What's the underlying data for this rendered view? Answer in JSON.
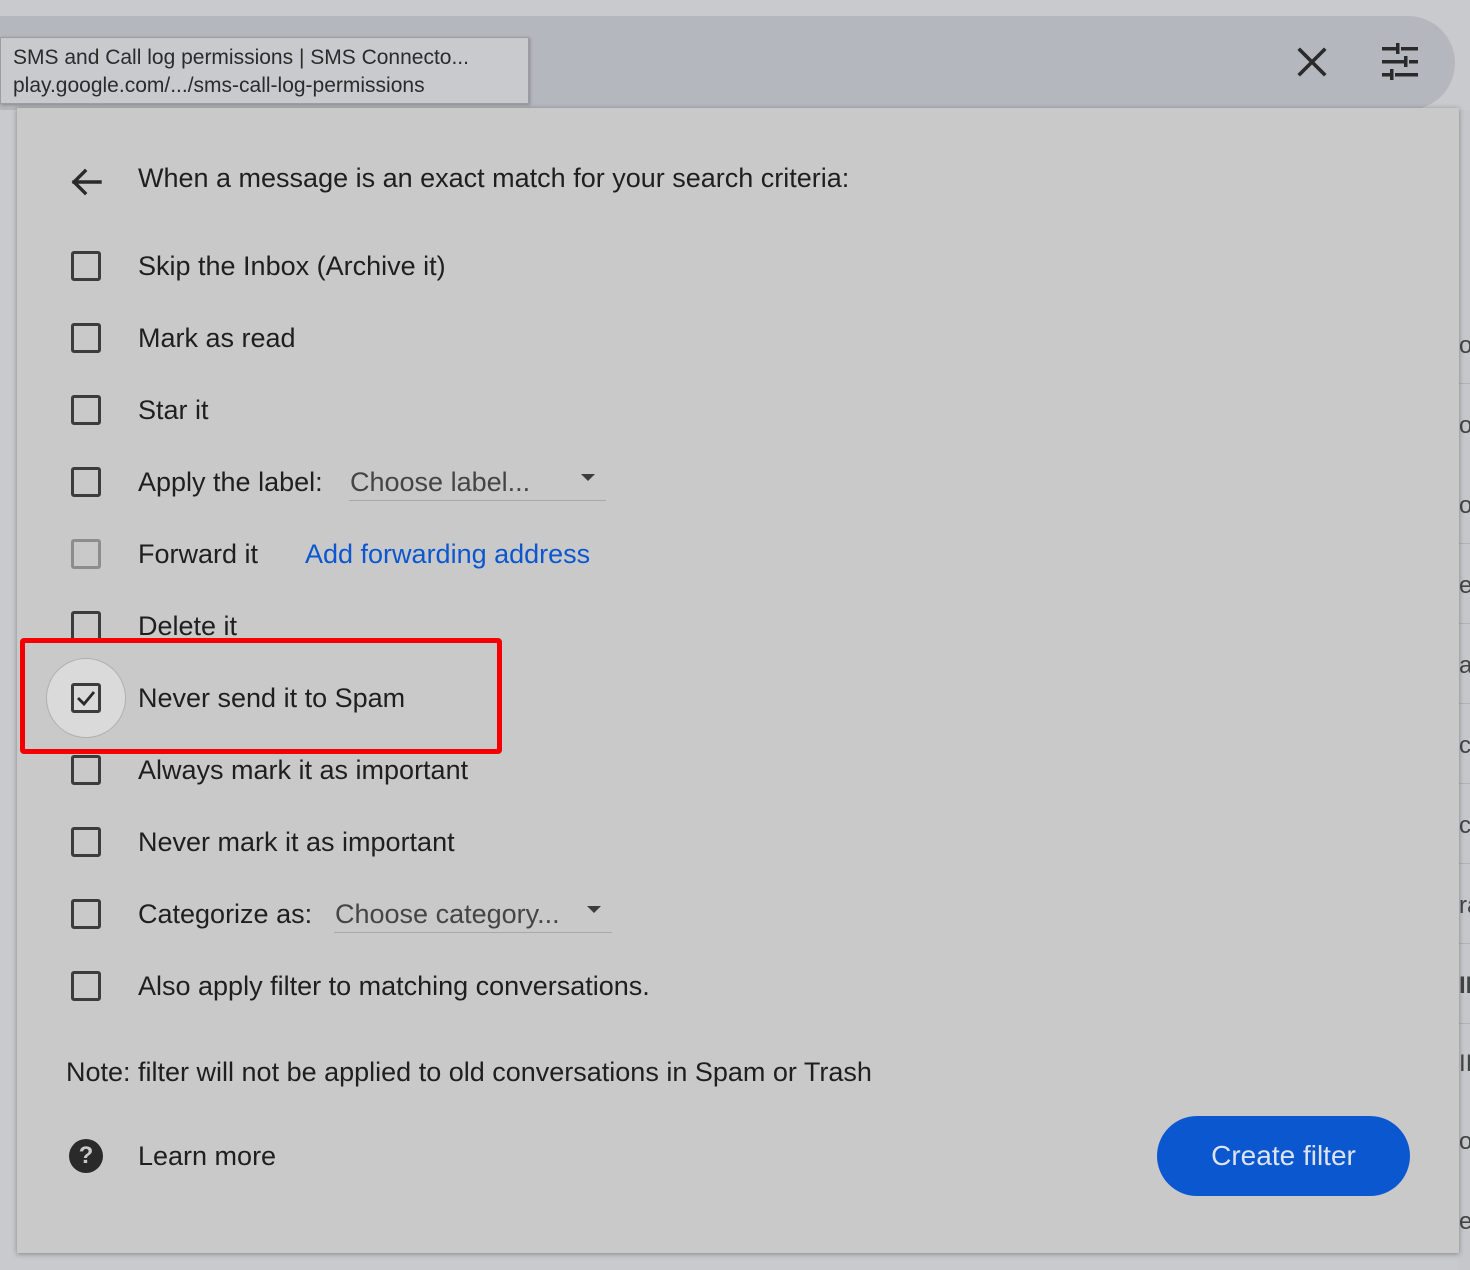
{
  "tooltip": {
    "title": "SMS and Call log permissions | SMS Connecto...",
    "url": "play.google.com/.../sms-call-log-permissions"
  },
  "search_bar": {
    "close_icon": "close-icon",
    "options_icon": "tune-icon"
  },
  "dialog": {
    "back_icon": "arrow-back-icon",
    "heading": "When a message is an exact match for your search criteria:",
    "options": [
      {
        "label": "Skip the Inbox (Archive it)",
        "checked": false
      },
      {
        "label": "Mark as read",
        "checked": false
      },
      {
        "label": "Star it",
        "checked": false
      },
      {
        "label": "Apply the label:",
        "checked": false
      },
      {
        "label": "Forward it",
        "checked": false,
        "disabled": true
      },
      {
        "label": "Delete it",
        "checked": false
      },
      {
        "label": "Never send it to Spam",
        "checked": true
      },
      {
        "label": "Always mark it as important",
        "checked": false
      },
      {
        "label": "Never mark it as important",
        "checked": false
      },
      {
        "label": "Categorize as:",
        "checked": false
      },
      {
        "label": "Also apply filter to matching conversations.",
        "checked": false
      }
    ],
    "label_select": "Choose label...",
    "category_select": "Choose category...",
    "forward_link": "Add forwarding address",
    "note": "Note: filter will not be applied to old conversations in Spam or Trash",
    "learn_more": "Learn more",
    "help_icon": "help-icon",
    "create_button": "Create filter",
    "accent_color": "#0b57d0",
    "highlight_color": "#f40000"
  },
  "background_fragments": [
    "ou",
    "o",
    "o",
    "e",
    "a",
    "c",
    "c",
    "ra",
    "II",
    "II",
    "o",
    "e"
  ]
}
